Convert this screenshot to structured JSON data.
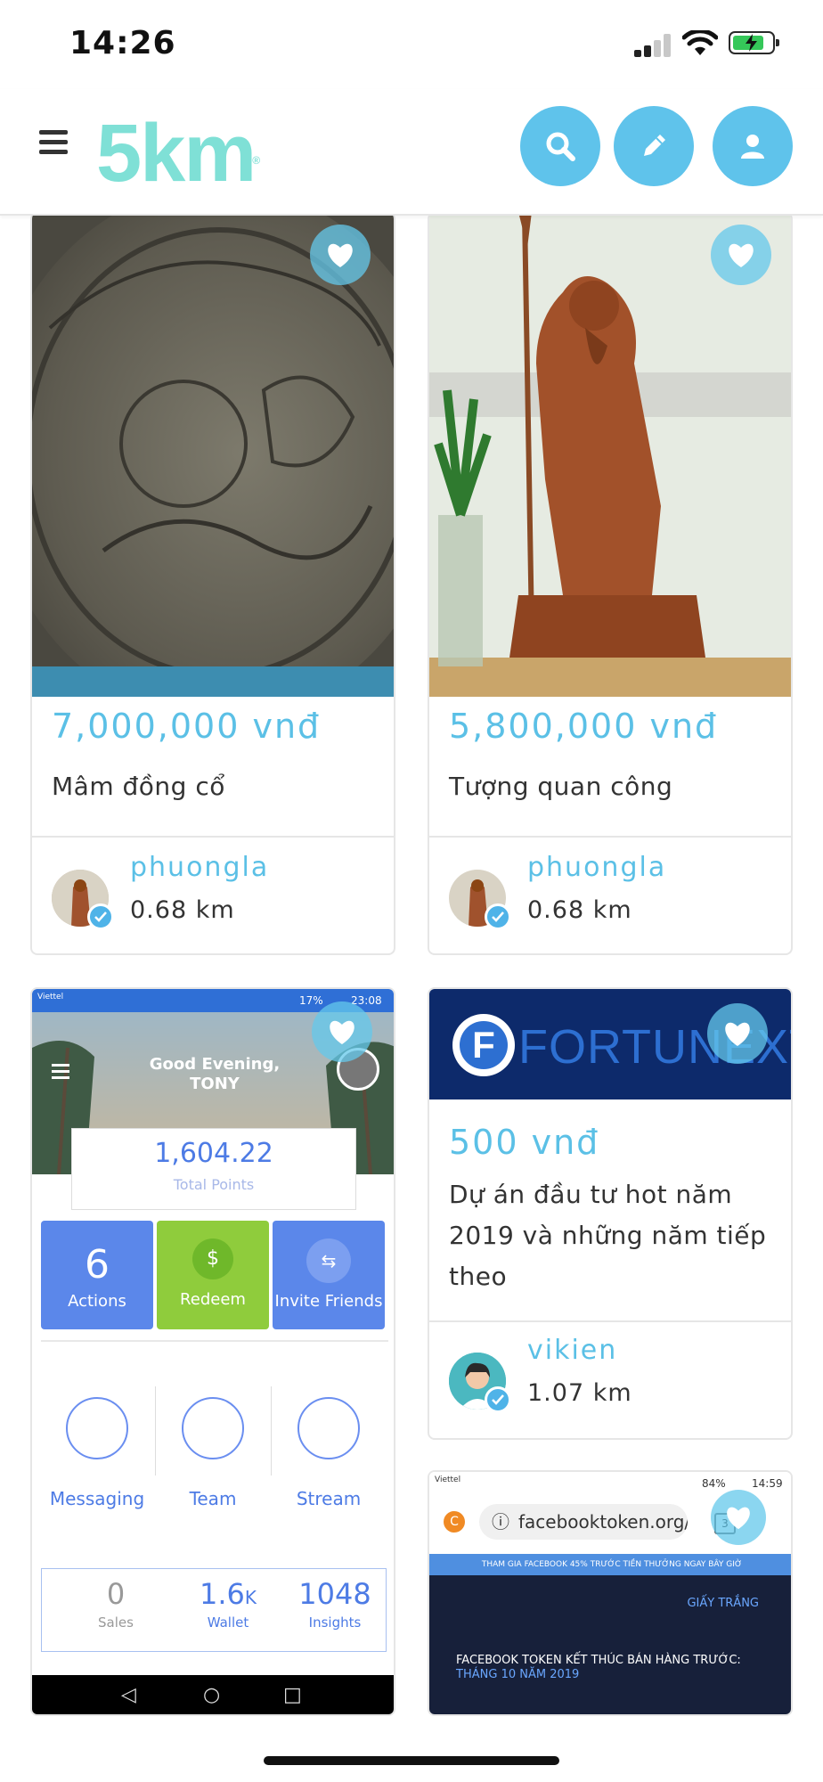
{
  "status": {
    "time": "14:26"
  },
  "header": {
    "logo": "5km",
    "logo_mark": "®",
    "menu_icon": "hamburger-icon",
    "buttons": [
      "search-icon",
      "pencil-icon",
      "user-icon"
    ]
  },
  "accent": "#5bc0e6",
  "listings": [
    {
      "price": "7,000,000 vnđ",
      "title": "Mâm đồng cổ",
      "user": "phuongla",
      "distance": "0.68 km"
    },
    {
      "price": "5,800,000 vnđ",
      "title": "Tượng quan công",
      "user": "phuongla",
      "distance": "0.68 km"
    },
    {
      "price": "500 vnđ",
      "title": "Dự án đầu tư hot năm 2019 và những năm tiếp theo",
      "user": "vikien",
      "distance": "1.07 km"
    }
  ],
  "app_shot": {
    "carrier": "Viettel",
    "battery": "17%",
    "clock": "23:08",
    "greeting_line1": "Good Evening,",
    "greeting_line2": "TONY",
    "points": "1,604.22",
    "points_label": "Total Points",
    "actions_count": "6",
    "actions_label": "Actions",
    "redeem_label": "Redeem",
    "invite_label": "Invite Friends",
    "messaging": "Messaging",
    "team": "Team",
    "stream": "Stream",
    "sales_value": "0",
    "sales_label": "Sales",
    "wallet_value": "1.6",
    "wallet_unit": "K",
    "wallet_label": "Wallet",
    "insights_value": "1048",
    "insights_label": "Insights"
  },
  "fortunext": {
    "logo": "FORTUNEXT"
  },
  "browser_shot": {
    "carrier": "Viettel",
    "battery": "84%",
    "clock": "14:59",
    "url": "facebooktoken.org/",
    "tabs": "3",
    "banner": "THAM GIA FACEBOOK 45% TRƯỚC TIỀN THƯỞNG NGAY BÂY GIỜ",
    "link": "GIẤY TRẮNG",
    "headline": "FACEBOOK TOKEN KẾT THÚC BÁN HÀNG TRƯỚC:",
    "headline_hl": "THÁNG",
    "headline_end": "10 NĂM 2019"
  }
}
